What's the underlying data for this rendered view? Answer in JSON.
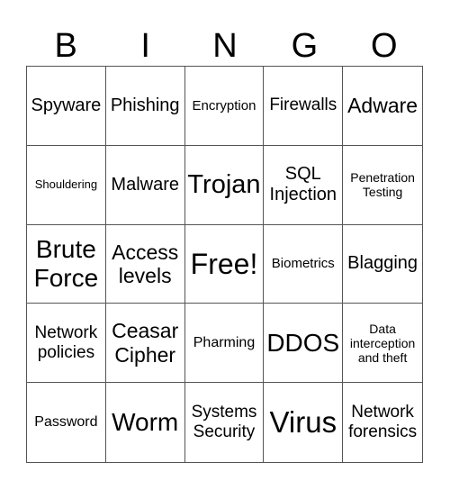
{
  "header": [
    "B",
    "I",
    "N",
    "G",
    "O"
  ],
  "cells": [
    {
      "text": "Spyware",
      "size": 20
    },
    {
      "text": "Phishing",
      "size": 20
    },
    {
      "text": "Encryption",
      "size": 15
    },
    {
      "text": "Firewalls",
      "size": 19
    },
    {
      "text": "Adware",
      "size": 23
    },
    {
      "text": "Shouldering",
      "size": 13
    },
    {
      "text": "Malware",
      "size": 20
    },
    {
      "text": "Trojan",
      "size": 29
    },
    {
      "text": "SQL Injection",
      "size": 20
    },
    {
      "text": "Penetration Testing",
      "size": 14
    },
    {
      "text": "Brute Force",
      "size": 28
    },
    {
      "text": "Access levels",
      "size": 23
    },
    {
      "text": "Free!",
      "size": 32
    },
    {
      "text": "Biometrics",
      "size": 15
    },
    {
      "text": "Blagging",
      "size": 20
    },
    {
      "text": "Network policies",
      "size": 19
    },
    {
      "text": "Ceasar Cipher",
      "size": 23
    },
    {
      "text": "Pharming",
      "size": 16
    },
    {
      "text": "DDOS",
      "size": 28
    },
    {
      "text": "Data interception and theft",
      "size": 14
    },
    {
      "text": "Password",
      "size": 16
    },
    {
      "text": "Worm",
      "size": 28
    },
    {
      "text": "Systems Security",
      "size": 19
    },
    {
      "text": "Virus",
      "size": 33
    },
    {
      "text": "Network forensics",
      "size": 19
    }
  ]
}
